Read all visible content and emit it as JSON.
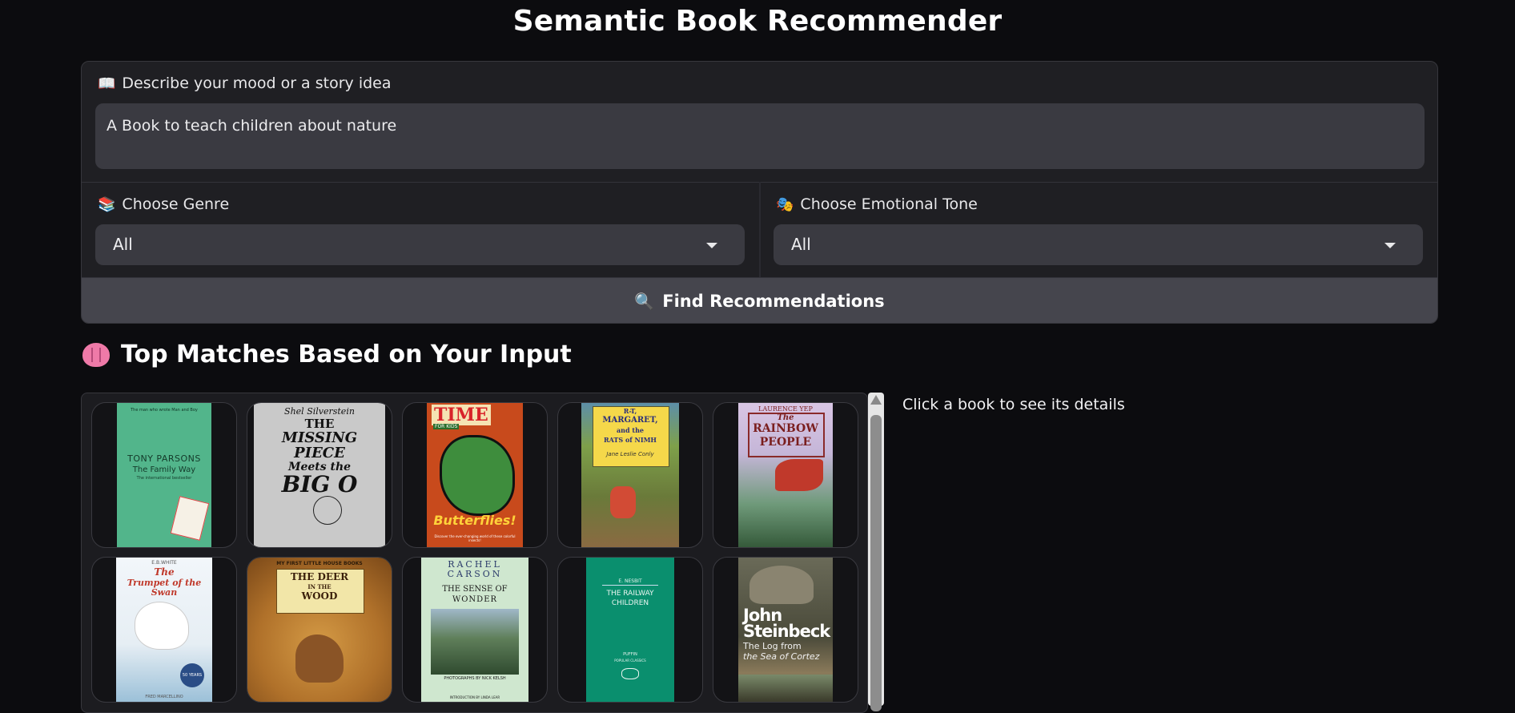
{
  "app": {
    "title": "Semantic Book Recommender"
  },
  "query": {
    "icon": "open-book-icon",
    "label": "Describe your mood or a story idea",
    "value": "A Book to teach children about nature"
  },
  "genre": {
    "icon": "books-icon",
    "label": "Choose Genre",
    "selected": "All"
  },
  "tone": {
    "icon": "theater-masks-icon",
    "label": "Choose Emotional Tone",
    "selected": "All"
  },
  "find_button": {
    "icon": "magnifier-icon",
    "label": "Find Recommendations"
  },
  "results": {
    "icon": "brain-icon",
    "title": "Top Matches Based on Your Input",
    "details_hint": "Click a book to see its details",
    "books": [
      {
        "top": "The Family Way",
        "t1": "TONY PARSONS",
        "t2": "The Family Way",
        "t3": "The international bestseller",
        "small": "The man who wrote Man and Boy",
        "color": "#52b58b"
      },
      {
        "t0": "Shel Silverstein",
        "t1": "THE",
        "t2": "MISSING PIECE",
        "t3": "Meets the",
        "t4": "BIG O",
        "color": "#c9c9c9"
      },
      {
        "t1": "TIME",
        "t2": "FOR KIDS",
        "t3": "Butterflies!",
        "t4": "Discover the ever-changing world of these colorful insects!",
        "color": "#c84a1c"
      },
      {
        "t1": "R-T,",
        "t2": "MARGARET,",
        "t3": "and the",
        "t4": "RATS of NIMH",
        "t5": "Jane Leslie Conly",
        "color": "#6b8a3a"
      },
      {
        "t1": "LAURENCE YEP",
        "t2": "The",
        "t3": "RAINBOW",
        "t4": "PEOPLE",
        "color": "#7a9cc0"
      },
      {
        "t0": "E.B.WHITE",
        "t1": "The",
        "t2": "Trumpet of the Swan",
        "t3": "50 YEARS",
        "t4": "FRED MARCELLINO",
        "color": "#eef4f8"
      },
      {
        "t0": "MY FIRST LITTLE HOUSE BOOKS",
        "t1": "THE DEER",
        "t2": "IN THE",
        "t3": "WOOD",
        "color": "#b57a2e"
      },
      {
        "t0": "RACHEL",
        "t1": "CARSON",
        "t2": "THE SENSE OF",
        "t3": "WONDER",
        "t4": "PHOTOGRAPHS BY NICK KELSH",
        "t5": "INTRODUCTION BY LINDA LEAR",
        "color": "#cfe7cf"
      },
      {
        "t0": "E. NESBIT",
        "t1": "THE RAILWAY",
        "t2": "CHILDREN",
        "t3": "PUFFIN",
        "t4": "POPULAR CLASSICS",
        "color": "#0a8f6e"
      },
      {
        "t1": "John",
        "t2": "Steinbeck",
        "t3": "The Log from",
        "t4": "the Sea of Cortez",
        "color": "#6a6a5a"
      }
    ]
  }
}
